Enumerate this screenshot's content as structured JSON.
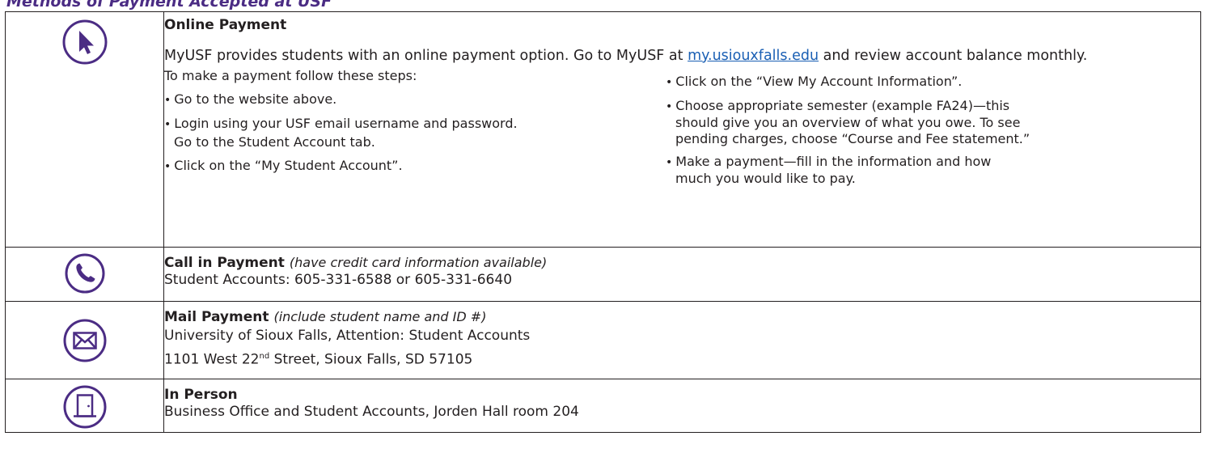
{
  "heading": "Methods of Payment Accepted at USF",
  "colors": {
    "accent": "#4b2c84",
    "link": "#1a5fb4",
    "border": "#231f20"
  },
  "online": {
    "icon": "cursor-arrow-icon",
    "title": "Online Payment",
    "intro_before": "MyUSF provides students with an online payment option. Go to MyUSF at ",
    "link": "my.usiouxfalls.edu",
    "intro_after": " and review account balance monthly.",
    "steps_intro": "To make a payment follow these steps:",
    "left_steps": [
      "Go to the website above.",
      "Login using your USF email username and password.",
      "Go to the Student Account tab.",
      "Click on the “My Student Account”."
    ],
    "right_steps": [
      "Click on the “View My Account Information”.",
      "Choose appropriate semester (example FA24)—this",
      "should give you an overview of what you owe. To see",
      "pending charges, choose “Course and Fee statement.”",
      "Make a payment—fill in the information and how",
      "much you would like to pay."
    ]
  },
  "call": {
    "icon": "phone-icon",
    "title": "Call in Payment",
    "note": "(have credit card information available)",
    "line1": "Student Accounts: 605-331-6588 or 605-331-6640"
  },
  "mail": {
    "icon": "envelope-icon",
    "title": "Mail Payment",
    "note": "(include student name and ID #)",
    "line1": "University of Sioux Falls, Attention: Student Accounts",
    "line2_pre": "1101 West 22",
    "line2_sup": "nd",
    "line2_post": " Street, Sioux Falls, SD 57105"
  },
  "person": {
    "icon": "door-icon",
    "title": "In Person",
    "line1": "Business Office and Student Accounts, Jorden Hall room 204"
  }
}
